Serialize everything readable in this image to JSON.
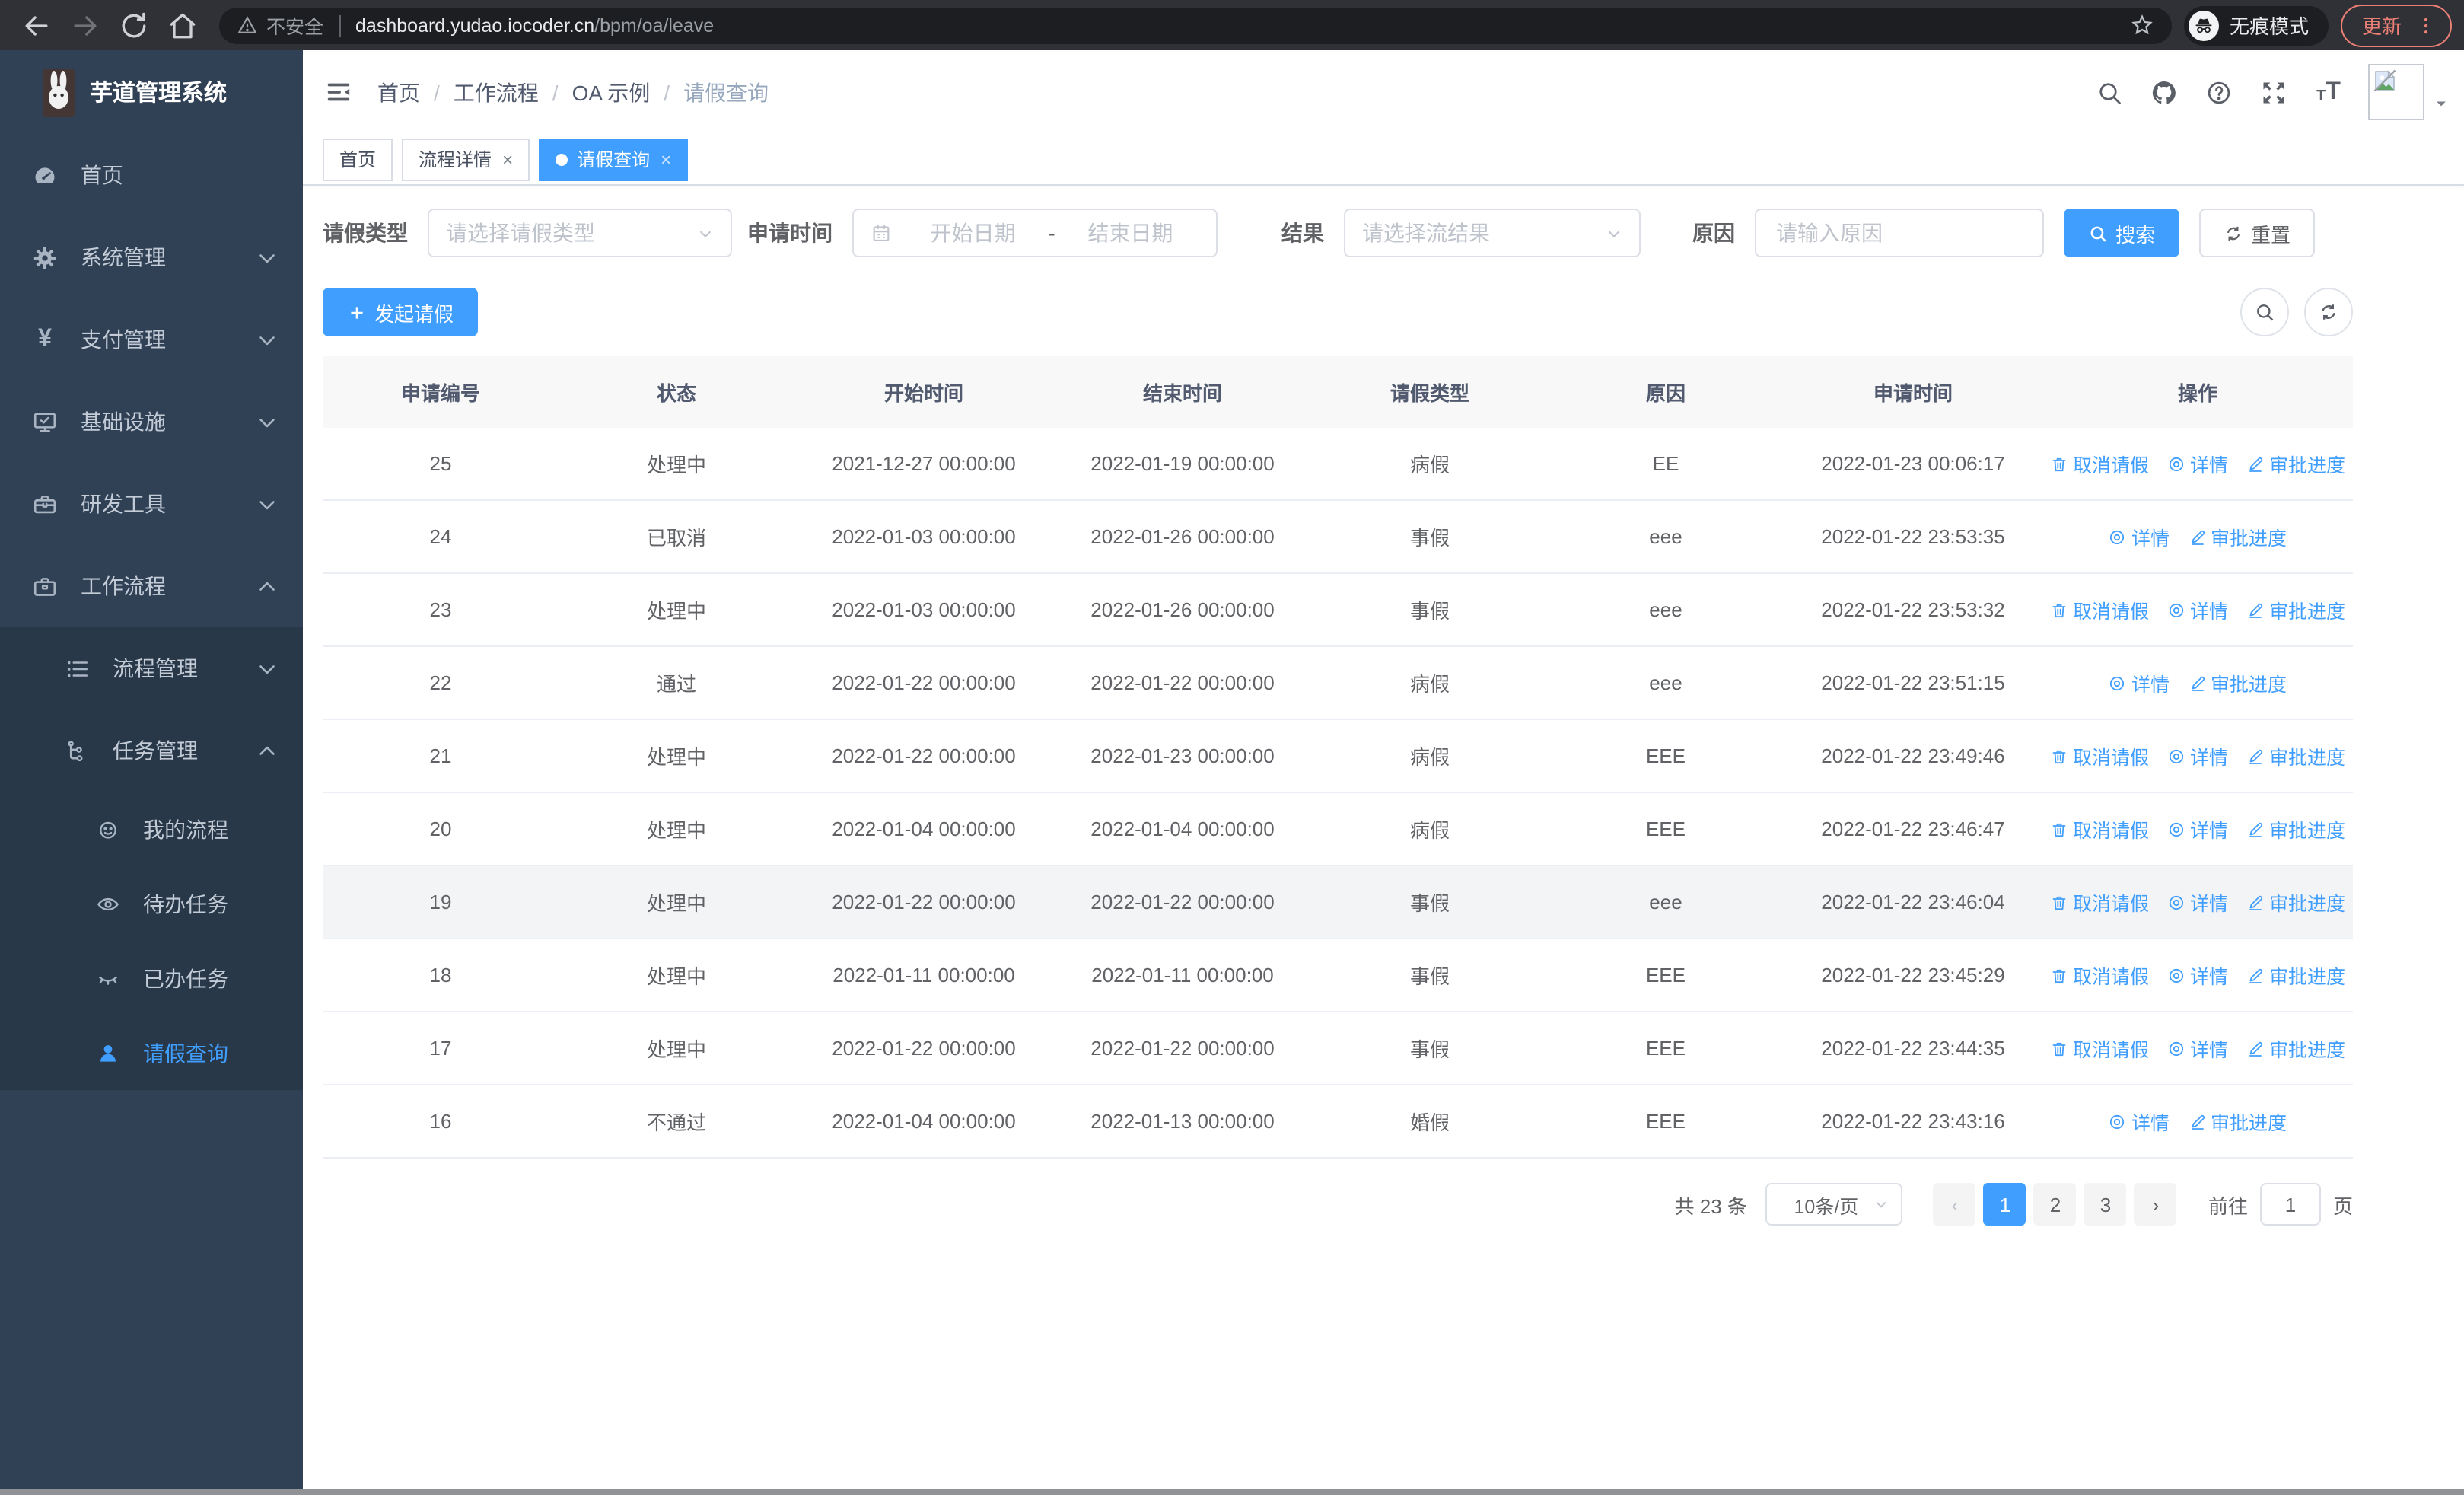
{
  "browser": {
    "security_label": "不安全",
    "url_host": "dashboard.yudao.iocoder.cn",
    "url_path": "/bpm/oa/leave",
    "incognito_label": "无痕模式",
    "update_label": "更新",
    "nav_icons": [
      "back-icon",
      "forward-icon",
      "reload-icon",
      "home-icon"
    ]
  },
  "app": {
    "title": "芋道管理系统",
    "accent_color": "#409eff",
    "header_icons": [
      "search-icon",
      "github-icon",
      "question-icon",
      "fullscreen-icon",
      "font-size-icon"
    ]
  },
  "breadcrumb": {
    "items": [
      "首页",
      "工作流程",
      "OA 示例",
      "请假查询"
    ]
  },
  "tabs": [
    {
      "key": "home",
      "label": "首页",
      "closable": false,
      "active": false
    },
    {
      "key": "process-detail",
      "label": "流程详情",
      "closable": true,
      "active": false
    },
    {
      "key": "leave-query",
      "label": "请假查询",
      "closable": true,
      "active": true
    }
  ],
  "sidebar": [
    {
      "key": "home",
      "icon": "gauge-icon",
      "label": "首页",
      "level": 1
    },
    {
      "key": "system",
      "icon": "gear-icon",
      "label": "系统管理",
      "level": 1,
      "chevron": "down"
    },
    {
      "key": "payment",
      "icon": "yen-icon",
      "label": "支付管理",
      "level": 1,
      "chevron": "down"
    },
    {
      "key": "infrastructure",
      "icon": "monitor-icon",
      "label": "基础设施",
      "level": 1,
      "chevron": "down"
    },
    {
      "key": "devtools",
      "icon": "toolbox-icon",
      "label": "研发工具",
      "level": 1,
      "chevron": "down"
    },
    {
      "key": "workflow",
      "icon": "briefcase-icon",
      "label": "工作流程",
      "level": 1,
      "chevron": "up"
    },
    {
      "key": "process-mgmt",
      "icon": "list-icon",
      "label": "流程管理",
      "level": 2,
      "chevron": "down",
      "sub": true
    },
    {
      "key": "task-mgmt",
      "icon": "share-icon",
      "label": "任务管理",
      "level": 2,
      "chevron": "up",
      "sub": true
    },
    {
      "key": "my-process",
      "icon": "face-icon",
      "label": "我的流程",
      "level": 3,
      "sub": true
    },
    {
      "key": "todo-task",
      "icon": "eye-icon",
      "label": "待办任务",
      "level": 3,
      "sub": true
    },
    {
      "key": "done-task",
      "icon": "eye-closed-icon",
      "label": "已办任务",
      "level": 3,
      "sub": true
    },
    {
      "key": "leave-query",
      "icon": "user-icon",
      "label": "请假查询",
      "level": 3,
      "sub": true,
      "active": true
    }
  ],
  "filters": {
    "leave_type": {
      "label": "请假类型",
      "placeholder": "请选择请假类型"
    },
    "apply_time": {
      "label": "申请时间",
      "start_placeholder": "开始日期",
      "separator": "-",
      "end_placeholder": "结束日期"
    },
    "result": {
      "label": "结果",
      "placeholder": "请选择流结果"
    },
    "reason": {
      "label": "原因",
      "placeholder": "请输入原因"
    },
    "search_label": "搜索",
    "reset_label": "重置"
  },
  "toolbar": {
    "create_label": "发起请假"
  },
  "table": {
    "columns": [
      "申请编号",
      "状态",
      "开始时间",
      "结束时间",
      "请假类型",
      "原因",
      "申请时间",
      "操作"
    ],
    "action_labels": {
      "cancel": "取消请假",
      "detail": "详情",
      "progress": "审批进度"
    },
    "rows": [
      {
        "cells": [
          "25",
          "处理中",
          "2021-12-27 00:00:00",
          "2022-01-19 00:00:00",
          "病假",
          "EE",
          "2022-01-23 00:06:17"
        ],
        "actions": [
          "cancel",
          "detail",
          "progress"
        ],
        "highlighted": false
      },
      {
        "cells": [
          "24",
          "已取消",
          "2022-01-03 00:00:00",
          "2022-01-26 00:00:00",
          "事假",
          "eee",
          "2022-01-22 23:53:35"
        ],
        "actions": [
          "detail",
          "progress"
        ],
        "highlighted": false
      },
      {
        "cells": [
          "23",
          "处理中",
          "2022-01-03 00:00:00",
          "2022-01-26 00:00:00",
          "事假",
          "eee",
          "2022-01-22 23:53:32"
        ],
        "actions": [
          "cancel",
          "detail",
          "progress"
        ],
        "highlighted": false
      },
      {
        "cells": [
          "22",
          "通过",
          "2022-01-22 00:00:00",
          "2022-01-22 00:00:00",
          "病假",
          "eee",
          "2022-01-22 23:51:15"
        ],
        "actions": [
          "detail",
          "progress"
        ],
        "highlighted": false
      },
      {
        "cells": [
          "21",
          "处理中",
          "2022-01-22 00:00:00",
          "2022-01-23 00:00:00",
          "病假",
          "EEE",
          "2022-01-22 23:49:46"
        ],
        "actions": [
          "cancel",
          "detail",
          "progress"
        ],
        "highlighted": false
      },
      {
        "cells": [
          "20",
          "处理中",
          "2022-01-04 00:00:00",
          "2022-01-04 00:00:00",
          "病假",
          "EEE",
          "2022-01-22 23:46:47"
        ],
        "actions": [
          "cancel",
          "detail",
          "progress"
        ],
        "highlighted": false
      },
      {
        "cells": [
          "19",
          "处理中",
          "2022-01-22 00:00:00",
          "2022-01-22 00:00:00",
          "事假",
          "eee",
          "2022-01-22 23:46:04"
        ],
        "actions": [
          "cancel",
          "detail",
          "progress"
        ],
        "highlighted": true
      },
      {
        "cells": [
          "18",
          "处理中",
          "2022-01-11 00:00:00",
          "2022-01-11 00:00:00",
          "事假",
          "EEE",
          "2022-01-22 23:45:29"
        ],
        "actions": [
          "cancel",
          "detail",
          "progress"
        ],
        "highlighted": false
      },
      {
        "cells": [
          "17",
          "处理中",
          "2022-01-22 00:00:00",
          "2022-01-22 00:00:00",
          "事假",
          "EEE",
          "2022-01-22 23:44:35"
        ],
        "actions": [
          "cancel",
          "detail",
          "progress"
        ],
        "highlighted": false
      },
      {
        "cells": [
          "16",
          "不通过",
          "2022-01-04 00:00:00",
          "2022-01-13 00:00:00",
          "婚假",
          "EEE",
          "2022-01-22 23:43:16"
        ],
        "actions": [
          "detail",
          "progress"
        ],
        "highlighted": false
      }
    ]
  },
  "pagination": {
    "total_label": "共 23 条",
    "page_size": "10条/页",
    "pages": [
      "1",
      "2",
      "3"
    ],
    "current": "1",
    "jump_label": "前往",
    "jump_value": "1",
    "unit_label": "页"
  }
}
